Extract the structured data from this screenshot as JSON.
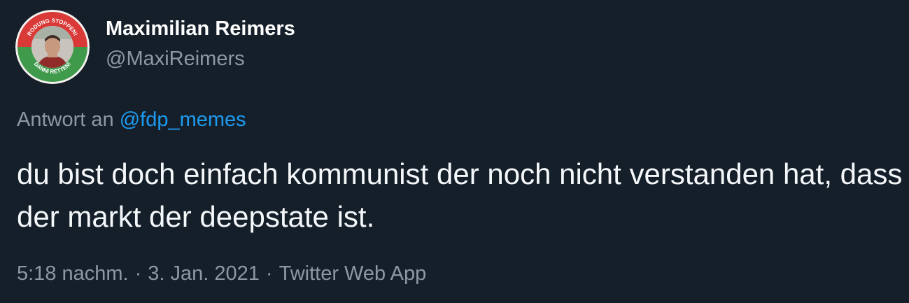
{
  "author": {
    "name": "Maximilian Reimers",
    "handle": "@MaxiReimers",
    "avatar_badge_top": "RODUNG STOPPEN!",
    "avatar_badge_bottom": "DANNI RETTEN!"
  },
  "reply": {
    "prefix": "Antwort an",
    "mention": "@fdp_memes"
  },
  "tweet": {
    "text": "du bist doch einfach kommunist der noch nicht verstanden hat, dass der markt der deepstate ist."
  },
  "meta": {
    "time": "5:18 nachm.",
    "separator": "·",
    "date": "3. Jan. 2021",
    "source": "Twitter Web App"
  },
  "colors": {
    "background": "#151f2a",
    "text": "#f5f8fa",
    "secondary": "#8b98a5",
    "link": "#1d9bf0",
    "badge_red": "#d93a37",
    "badge_green": "#3f9a4c"
  }
}
